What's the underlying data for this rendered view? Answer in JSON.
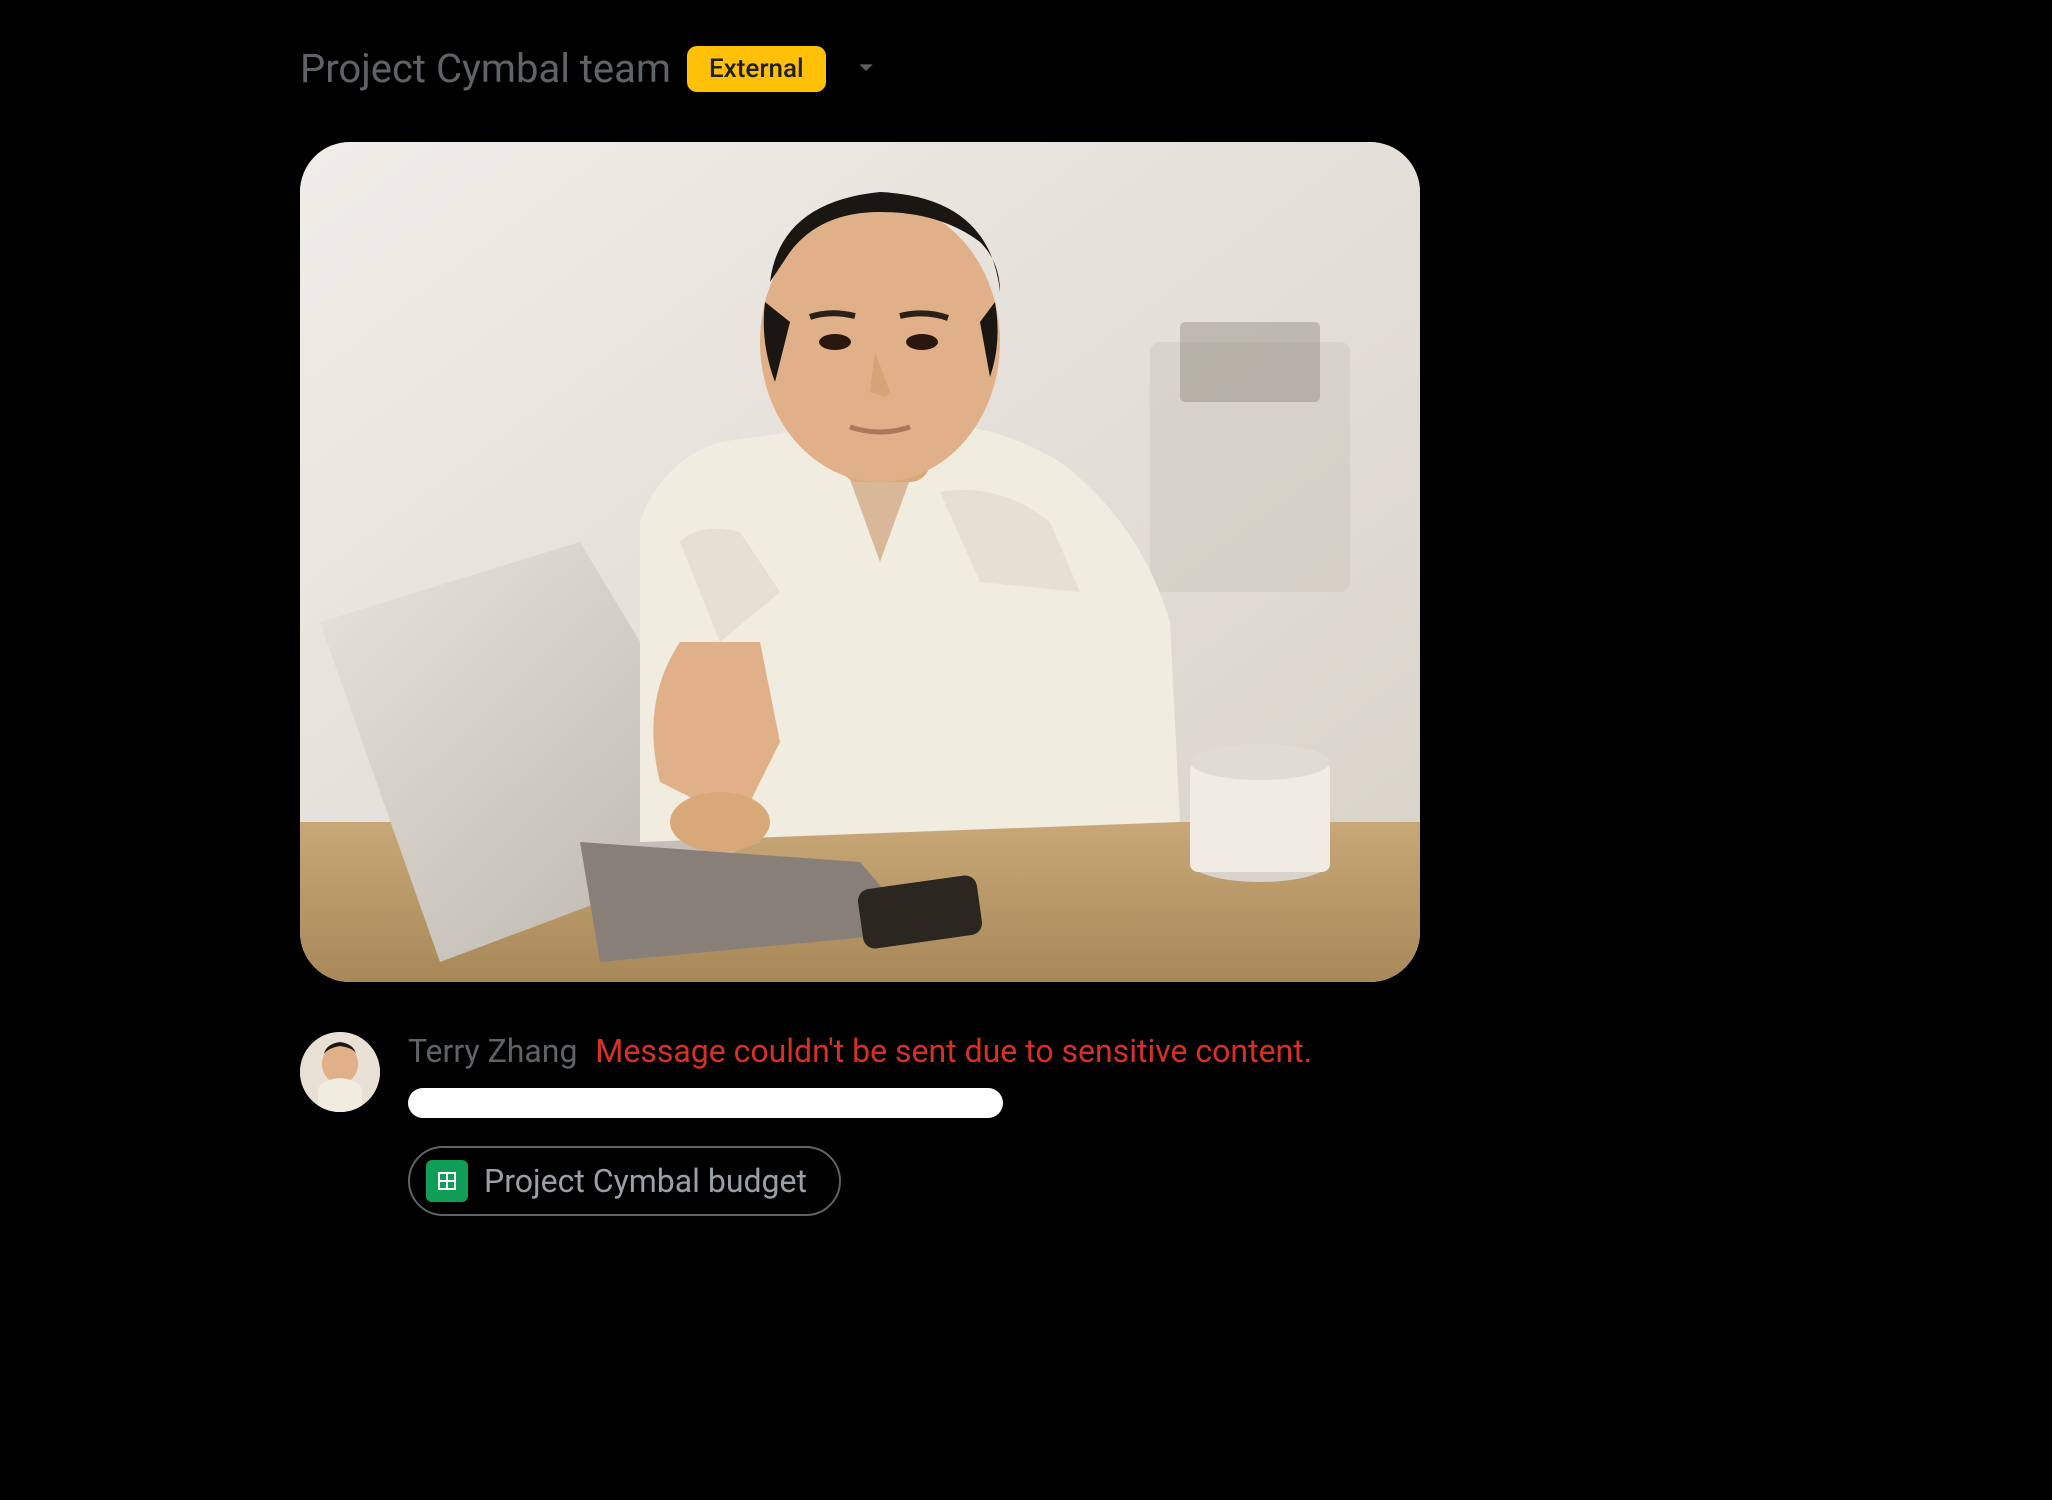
{
  "header": {
    "title": "Project Cymbal team",
    "badge": "External"
  },
  "message": {
    "sender": "Terry Zhang",
    "error": "Message couldn't be sent due to sensitive content.",
    "attachment": {
      "name": "Project Cymbal budget",
      "type": "google-sheets"
    }
  },
  "icons": {
    "dropdown": "chevron-down-icon",
    "sheets": "google-sheets-icon"
  },
  "colors": {
    "badge_bg": "#ffc107",
    "error": "#d93025",
    "sheets": "#0f9d58",
    "muted": "#5f6368"
  }
}
